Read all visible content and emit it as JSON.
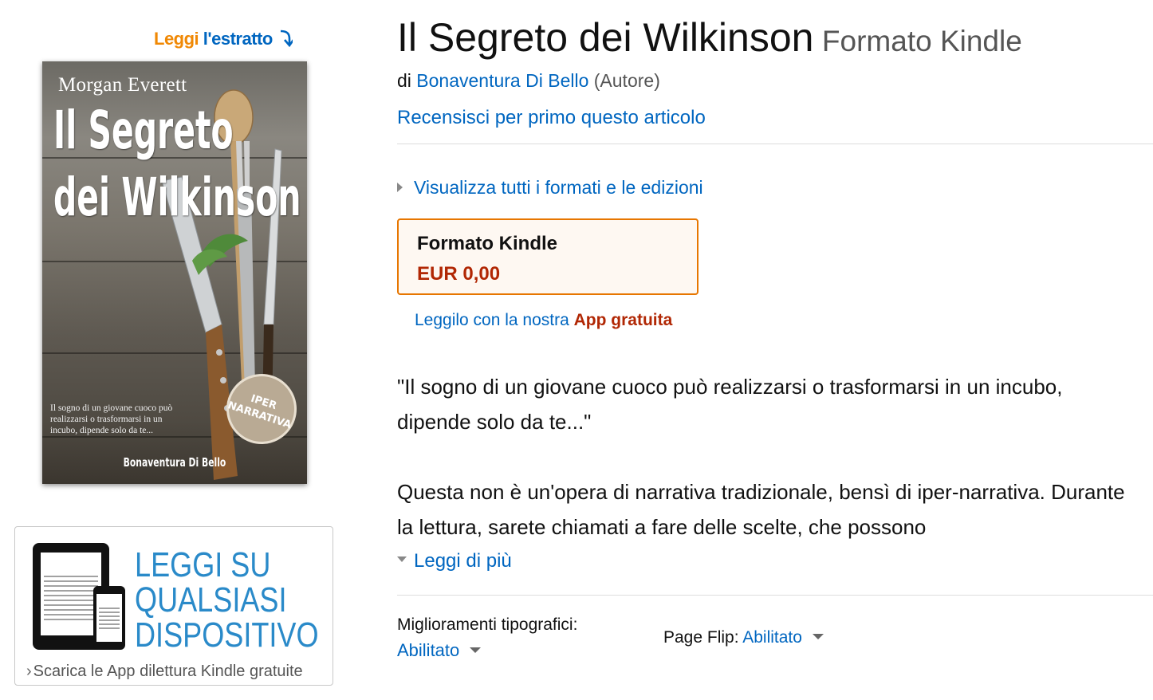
{
  "look_inside": {
    "part1": "Leggi",
    "part2": " l'estratto"
  },
  "cover": {
    "author": "Morgan Everett",
    "title_line1": "Il Segreto",
    "title_line2": "dei Wilkinson",
    "blurb": "Il sogno di un giovane cuoco può realizzarsi o trasformarsi in un incubo, dipende solo da te...",
    "badge_line1": "IPER",
    "badge_line2": "NARRATIVA",
    "bottom_author": "Bonaventura Di Bello"
  },
  "apps_promo": {
    "headline_line1": "LEGGI SU",
    "headline_line2": "QUALSIASI",
    "headline_line3": "DISPOSITIVO",
    "link": "Scarica le App dilettura Kindle gratuite"
  },
  "product": {
    "title": "Il Segreto dei Wilkinson",
    "format_subtitle": "Formato Kindle",
    "by_prefix": "di ",
    "author": "Bonaventura Di Bello",
    "author_role": " (Autore)",
    "review_link": "Recensisci per primo questo articolo",
    "formats_link": "Visualizza tutti i formati e le edizioni",
    "format_box": {
      "name": "Formato Kindle",
      "price": "EUR 0,00"
    },
    "app_line_prefix": "Leggilo con la nostra ",
    "app_line_link": "App gratuita",
    "description_p1": "\"Il sogno di un giovane cuoco può realizzarsi o trasformarsi in un incubo, dipende solo da te...\"",
    "description_p2": "Questa non è un'opera di narrativa tradizionale, bensì di iper-narrativa. Durante la lettura, sarete chiamati a fare delle scelte, che possono",
    "read_more": "Leggi di più",
    "typography_label": "Miglioramenti tipografici:",
    "typography_value": "Abilitato",
    "pageflip_label": "Page Flip: ",
    "pageflip_value": "Abilitato"
  },
  "colors": {
    "link": "#0066c0",
    "price": "#b12704",
    "format_border": "#e77600",
    "promo_blue": "#2a8ac9",
    "look_inside_orange": "#f08804"
  }
}
